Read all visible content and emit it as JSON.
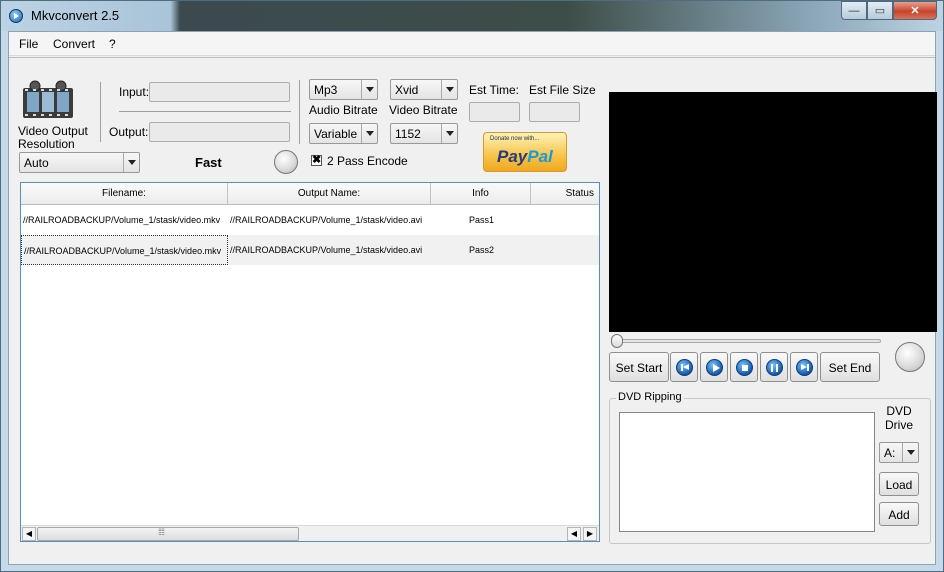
{
  "window": {
    "title": "Mkvconvert 2.5",
    "min": "—",
    "max": "▭",
    "close": "✕"
  },
  "menu": [
    "File",
    "Convert",
    "?"
  ],
  "controls": {
    "video_output_resolution_label": "Video Output\nResolution",
    "resolution_value": "Auto",
    "input_label": "Input:",
    "output_label": "Output:",
    "input_value": "",
    "output_value": "",
    "speed_label": "Fast",
    "audio_codec": "Mp3",
    "video_codec": "Xvid",
    "audio_bitrate_label": "Audio Bitrate",
    "video_bitrate_label": "Video Bitrate",
    "audio_bitrate_value": "Variable",
    "video_bitrate_value": "1152",
    "two_pass_label": "2 Pass Encode",
    "two_pass_checked": true,
    "two_pass_mark": "✖",
    "est_time_label": "Est Time:",
    "est_file_size_label": "Est File Size",
    "est_time_value": "",
    "est_file_size_value": ""
  },
  "paypal": {
    "caption": "Donate now with...",
    "pay": "Pay",
    "pal": "Pal"
  },
  "table": {
    "columns": [
      "Filename:",
      "Output Name:",
      "Info",
      "Status"
    ],
    "rows": [
      [
        "//RAILROADBACKUP/Volume_1/stask/video.mkv",
        "//RAILROADBACKUP/Volume_1/stask/video.avi",
        "Pass1",
        ""
      ],
      [
        "//RAILROADBACKUP/Volume_1/stask/video.mkv",
        "//RAILROADBACKUP/Volume_1/stask/video.avi",
        "Pass2",
        ""
      ]
    ]
  },
  "player": {
    "set_start": "Set Start",
    "set_end": "Set End",
    "position": 0
  },
  "dvd": {
    "group_title": "DVD Ripping",
    "drive_label": "DVD\nDrive",
    "drive_value": "A:",
    "load": "Load",
    "add": "Add"
  },
  "scroll": {
    "left": "◀",
    "right": "▶",
    "right2": "◀"
  }
}
